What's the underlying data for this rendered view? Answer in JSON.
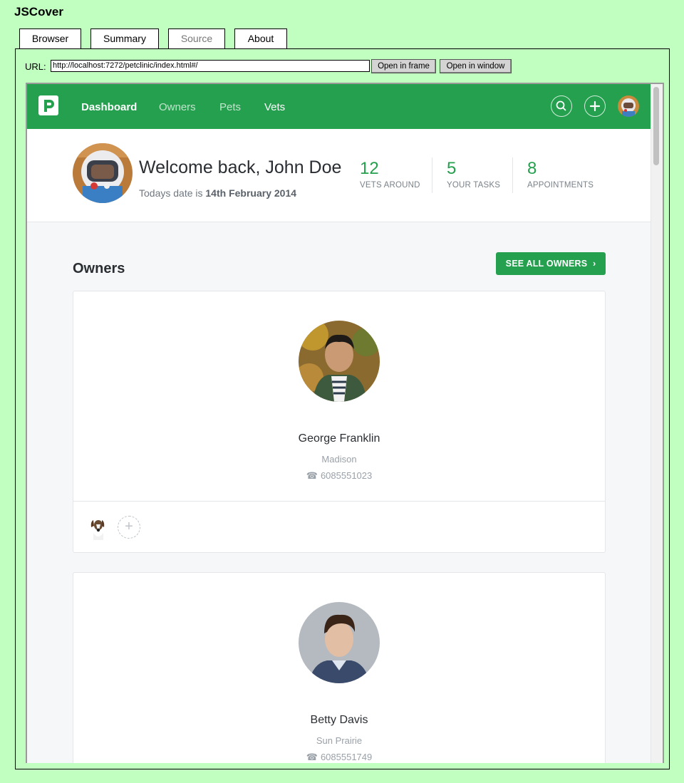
{
  "app": {
    "title": "JSCover"
  },
  "tabs": [
    {
      "label": "Browser"
    },
    {
      "label": "Summary"
    },
    {
      "label": "Source"
    },
    {
      "label": "About"
    }
  ],
  "url_bar": {
    "label": "URL:",
    "value": "http://localhost:7272/petclinic/index.html#/",
    "open_frame_label": "Open in frame",
    "open_window_label": "Open in window"
  },
  "site": {
    "brand_color": "#24a04e",
    "logo_icon": "petclinic-logo-icon",
    "nav": [
      {
        "label": "Dashboard"
      },
      {
        "label": "Owners"
      },
      {
        "label": "Pets"
      },
      {
        "label": "Vets"
      }
    ],
    "welcome": {
      "title": "Welcome back, John Doe",
      "date_prefix": "Todays date is",
      "date_value": "14th February 2014"
    },
    "stats": [
      {
        "value": "12",
        "label": "VETS AROUND"
      },
      {
        "value": "5",
        "label": "YOUR TASKS"
      },
      {
        "value": "8",
        "label": "APPOINTMENTS"
      }
    ],
    "owners_section": {
      "title": "Owners",
      "see_all_label": "SEE ALL OWNERS"
    },
    "owners": [
      {
        "name": "George Franklin",
        "city": "Madison",
        "phone": "6085551023"
      },
      {
        "name": "Betty Davis",
        "city": "Sun Prairie",
        "phone": "6085551749"
      }
    ]
  }
}
